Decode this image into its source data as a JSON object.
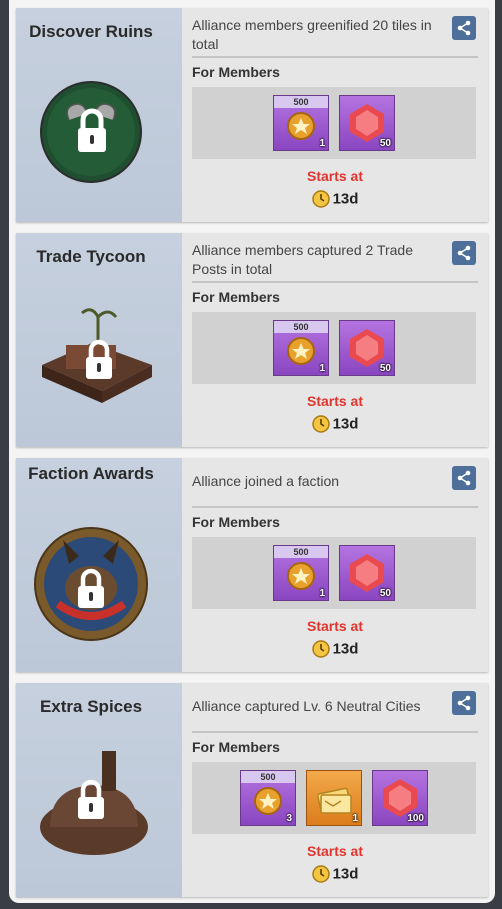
{
  "cards": [
    {
      "title": "Discover Ruins",
      "description": "Alliance members greenified 20 tiles in total",
      "for_members": "For Members",
      "rewards": [
        {
          "icon": "badge-icon",
          "tag": "500",
          "qty": "1"
        },
        {
          "icon": "ruby-icon",
          "qty": "50"
        }
      ],
      "starts_label": "Starts at",
      "time": "13d"
    },
    {
      "title": "Trade Tycoon",
      "description": "Alliance members captured 2 Trade Posts in total",
      "for_members": "For Members",
      "rewards": [
        {
          "icon": "badge-icon",
          "tag": "500",
          "qty": "1"
        },
        {
          "icon": "ruby-icon",
          "qty": "50"
        }
      ],
      "starts_label": "Starts at",
      "time": "13d"
    },
    {
      "title": "Faction Awards",
      "description": "Alliance joined a faction",
      "for_members": "For Members",
      "rewards": [
        {
          "icon": "badge-icon",
          "tag": "500",
          "qty": "1"
        },
        {
          "icon": "ruby-icon",
          "qty": "50"
        }
      ],
      "starts_label": "Starts at",
      "time": "13d"
    },
    {
      "title": "Extra Spices",
      "description": "Alliance captured Lv. 6 Neutral Cities",
      "for_members": "For Members",
      "rewards": [
        {
          "icon": "badge-icon",
          "tag": "500",
          "qty": "3"
        },
        {
          "icon": "gold-ticket-icon",
          "qty": "1"
        },
        {
          "icon": "ruby-icon",
          "qty": "100"
        }
      ],
      "starts_label": "Starts at",
      "time": "13d"
    }
  ],
  "colors": {
    "starts_red": "#e0342f",
    "share_blue": "#4d6f9a",
    "reward_purple": "#a35fd6",
    "reward_orange": "#e8902e"
  }
}
